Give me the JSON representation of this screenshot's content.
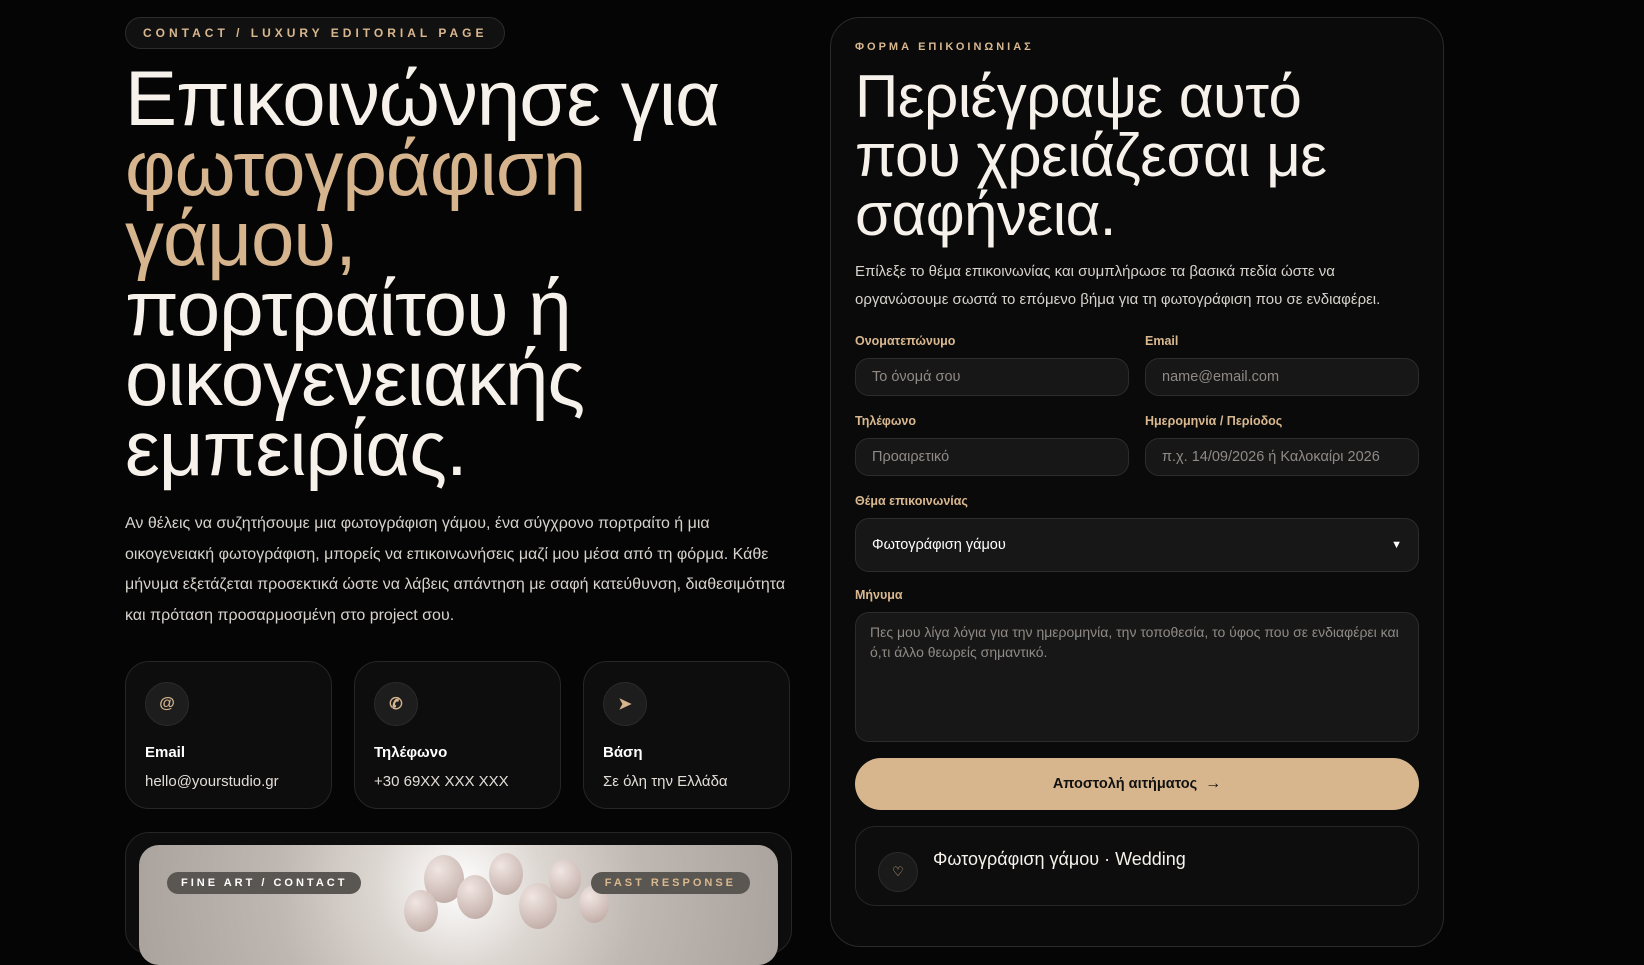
{
  "left": {
    "eyebrow": "CONTACT / LUXURY EDITORIAL PAGE",
    "headline_line1": "Επικοινώνησε για",
    "headline_accent": "φωτογράφιση γάμου,",
    "headline_rest": "πορτραίτου ή οικογενειακής εμπειρίας.",
    "intro": "Αν θέλεις να συζητήσουμε μια φωτογράφιση γάμου, ένα σύγχρονο πορτραίτο ή μια οικογενειακή φωτογράφιση, μπορείς να επικοινωνήσεις μαζί μου μέσα από τη φόρμα. Κάθε μήνυμα εξετάζεται προσεκτικά ώστε να λάβεις απάντηση με σαφή κατεύθυνση, διαθεσιμότητα και πρόταση προσαρμοσμένη στο project σου.",
    "cards": [
      {
        "icon": "at-icon",
        "glyph": "@",
        "title": "Email",
        "value": "hello@yourstudio.gr"
      },
      {
        "icon": "phone-icon",
        "glyph": "✆",
        "title": "Τηλέφωνο",
        "value": "+30 69XX XXX XXX"
      },
      {
        "icon": "location-arrow-icon",
        "glyph": "➤",
        "title": "Βάση",
        "value": "Σε όλη την Ελλάδα"
      }
    ],
    "hero": {
      "badge_left": "FINE ART / CONTACT",
      "badge_right": "FAST RESPONSE"
    }
  },
  "form": {
    "eyebrow": "ΦΟΡΜΑ ΕΠΙΚΟΙΝΩΝΙΑΣ",
    "title": "Περιέγραψε αυτό που χρειάζεσαι με σαφήνεια.",
    "lead": "Επίλεξε το θέμα επικοινωνίας και συμπλήρωσε τα βασικά πεδία ώστε να οργανώσουμε σωστά το επόμενο βήμα για τη φωτογράφιση που σε ενδιαφέρει.",
    "name_label": "Ονοματεπώνυμο",
    "name_placeholder": "Το όνομά σου",
    "email_label": "Email",
    "email_placeholder": "name@email.com",
    "phone_label": "Τηλέφωνο",
    "phone_placeholder": "Προαιρετικό",
    "date_label": "Ημερομηνία / Περίοδος",
    "date_placeholder": "π.χ. 14/09/2026 ή Καλοκαίρι 2026",
    "topic_label": "Θέμα επικοινωνίας",
    "topic_value": "Φωτογράφιση γάμου",
    "message_label": "Μήνυμα",
    "message_placeholder": "Πες μου λίγα λόγια για την ημερομηνία, την τοποθεσία, το ύφος που σε ενδιαφέρει και ό,τι άλλο θεωρείς σημαντικό.",
    "submit_label": "Αποστολή αιτήματος",
    "service_title": "Φωτογράφιση γάμου · Wedding"
  },
  "colors": {
    "accent": "#d5b48e",
    "background": "#050505",
    "button": "#d7b68d"
  }
}
